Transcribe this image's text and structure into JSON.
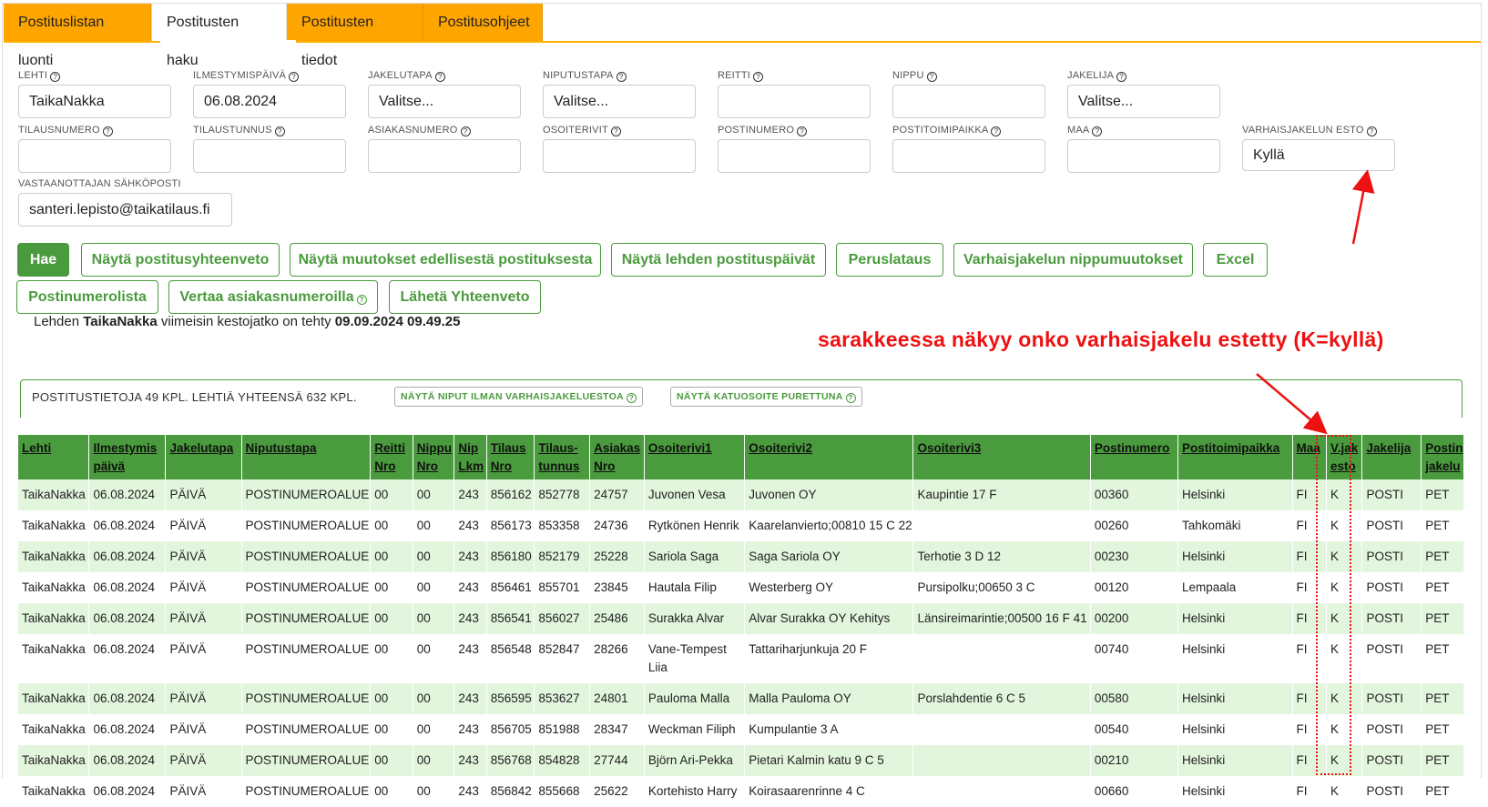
{
  "tabs": [
    {
      "label": "Postituslistan luonti",
      "active": false
    },
    {
      "label": "Postitusten haku",
      "active": true
    },
    {
      "label": "Postitusten tiedot",
      "active": false
    },
    {
      "label": "Postitusohjeet",
      "active": false
    }
  ],
  "form": {
    "lehti": {
      "label": "LEHTI",
      "value": "TaikaNakka"
    },
    "ilmestymispaiva": {
      "label": "ILMESTYMISPÄIVÄ",
      "value": "06.08.2024"
    },
    "jakelutapa": {
      "label": "JAKELUTAPA",
      "value": "Valitse..."
    },
    "niputustapa": {
      "label": "NIPUTUSTAPA",
      "value": "Valitse..."
    },
    "reitti": {
      "label": "REITTI",
      "value": ""
    },
    "nippu": {
      "label": "NIPPU",
      "value": ""
    },
    "jakelija": {
      "label": "JAKELIJA",
      "value": "Valitse..."
    },
    "tilausnumero": {
      "label": "TILAUSNUMERO",
      "value": ""
    },
    "tilaustunnus": {
      "label": "TILAUSTUNNUS",
      "value": ""
    },
    "asiakasnumero": {
      "label": "ASIAKASNUMERO",
      "value": ""
    },
    "osoiterivit": {
      "label": "OSOITERIVIT",
      "value": ""
    },
    "postinumero": {
      "label": "POSTINUMERO",
      "value": ""
    },
    "postitoimipaikka": {
      "label": "POSTITOIMIPAIKKA",
      "value": ""
    },
    "maa": {
      "label": "MAA",
      "value": ""
    },
    "varhaisjakelun_esto": {
      "label": "VARHAISJAKELUN ESTO",
      "value": "Kyllä"
    },
    "sahkoposti": {
      "label": "VASTAANOTTAJAN SÄHKÖPOSTI",
      "value": "santeri.lepisto@taikatilaus.fi"
    }
  },
  "help_glyph": "?",
  "buttons": {
    "hae": "Hae",
    "yhteenveto": "Näytä postitusyhteenveto",
    "muutokset": "Näytä muutokset edellisestä postituksesta",
    "postituspaivat": "Näytä lehden postituspäivät",
    "peruslataus": "Peruslataus",
    "nippumuutokset": "Varhaisjakelun nippumuutokset",
    "excel": "Excel",
    "postinumerolista": "Postinumerolista",
    "vertaa": "Vertaa asiakasnumeroilla",
    "laheta": "Lähetä Yhteenveto"
  },
  "info": {
    "prefix": "Lehden ",
    "paper": "TaikaNakka",
    "middle": " viimeisin kestojatko on tehty ",
    "datetime": "09.09.2024 09.49.25"
  },
  "annotation": "sarakkeessa näkyy onko varhaisjakelu estetty (K=kyllä)",
  "summary": {
    "text": "POSTITUSTIETOJA 49 KPL. LEHTIÄ YHTEENSÄ 632 KPL.",
    "btn_niput": "NÄYTÄ NIPUT ILMAN VARHAISJAKELUESTOA",
    "btn_katuosoite": "NÄYTÄ KATUOSOITE PURETTUNA"
  },
  "table": {
    "headers": [
      {
        "l1": "Lehti",
        "l2": ""
      },
      {
        "l1": "Ilmestymis",
        "l2": "päivä"
      },
      {
        "l1": "Jakelutapa",
        "l2": ""
      },
      {
        "l1": "Niputustapa",
        "l2": ""
      },
      {
        "l1": "Reitti",
        "l2": "Nro"
      },
      {
        "l1": "Nippu",
        "l2": "Nro"
      },
      {
        "l1": "Nip",
        "l2": "Lkm"
      },
      {
        "l1": "Tilaus",
        "l2": "Nro"
      },
      {
        "l1": "Tilaus-",
        "l2": "tunnus"
      },
      {
        "l1": "Asiakas",
        "l2": "Nro"
      },
      {
        "l1": "Osoiterivi1",
        "l2": ""
      },
      {
        "l1": "Osoiterivi2",
        "l2": ""
      },
      {
        "l1": "Osoiterivi3",
        "l2": ""
      },
      {
        "l1": "Postinumero",
        "l2": ""
      },
      {
        "l1": "Postitoimipaikka",
        "l2": ""
      },
      {
        "l1": "Maa",
        "l2": ""
      },
      {
        "l1": "V.jak",
        "l2": "esto"
      },
      {
        "l1": "Jakelija",
        "l2": ""
      },
      {
        "l1": "Postin",
        "l2": "jakelu"
      }
    ],
    "rows": [
      [
        "TaikaNakka",
        "06.08.2024",
        "PÄIVÄ",
        "POSTINUMEROALUE",
        "00",
        "00",
        "243",
        "856162",
        "852778",
        "24757",
        "Juvonen Vesa",
        "Juvonen OY",
        "Kaupintie 17 F",
        "00360",
        "Helsinki",
        "FI",
        "K",
        "POSTI",
        "PET"
      ],
      [
        "TaikaNakka",
        "06.08.2024",
        "PÄIVÄ",
        "POSTINUMEROALUE",
        "00",
        "00",
        "243",
        "856173",
        "853358",
        "24736",
        "Rytkönen Henrik",
        "Kaarelanvierto;00810 15 C 22",
        "",
        "00260",
        "Tahkomäki",
        "FI",
        "K",
        "POSTI",
        "PET"
      ],
      [
        "TaikaNakka",
        "06.08.2024",
        "PÄIVÄ",
        "POSTINUMEROALUE",
        "00",
        "00",
        "243",
        "856180",
        "852179",
        "25228",
        "Sariola Saga",
        "Saga Sariola OY",
        "Terhotie 3 D 12",
        "00230",
        "Helsinki",
        "FI",
        "K",
        "POSTI",
        "PET"
      ],
      [
        "TaikaNakka",
        "06.08.2024",
        "PÄIVÄ",
        "POSTINUMEROALUE",
        "00",
        "00",
        "243",
        "856461",
        "855701",
        "23845",
        "Hautala Filip",
        "Westerberg OY",
        "Pursipolku;00650 3 C",
        "00120",
        "Lempaala",
        "FI",
        "K",
        "POSTI",
        "PET"
      ],
      [
        "TaikaNakka",
        "06.08.2024",
        "PÄIVÄ",
        "POSTINUMEROALUE",
        "00",
        "00",
        "243",
        "856541",
        "856027",
        "25486",
        "Surakka Alvar",
        "Alvar Surakka OY Kehitys",
        "Länsireimarintie;00500 16 F 41",
        "00200",
        "Helsinki",
        "FI",
        "K",
        "POSTI",
        "PET"
      ],
      [
        "TaikaNakka",
        "06.08.2024",
        "PÄIVÄ",
        "POSTINUMEROALUE",
        "00",
        "00",
        "243",
        "856548",
        "852847",
        "28266",
        "Vane-Tempest Liia",
        "Tattariharjunkuja 20 F",
        "",
        "00740",
        "Helsinki",
        "FI",
        "K",
        "POSTI",
        "PET"
      ],
      [
        "TaikaNakka",
        "06.08.2024",
        "PÄIVÄ",
        "POSTINUMEROALUE",
        "00",
        "00",
        "243",
        "856595",
        "853627",
        "24801",
        "Pauloma Malla",
        "Malla Pauloma OY",
        "Porslahdentie 6 C 5",
        "00580",
        "Helsinki",
        "FI",
        "K",
        "POSTI",
        "PET"
      ],
      [
        "TaikaNakka",
        "06.08.2024",
        "PÄIVÄ",
        "POSTINUMEROALUE",
        "00",
        "00",
        "243",
        "856705",
        "851988",
        "28347",
        "Weckman Filiph",
        "Kumpulantie 3 A",
        "",
        "00540",
        "Helsinki",
        "FI",
        "K",
        "POSTI",
        "PET"
      ],
      [
        "TaikaNakka",
        "06.08.2024",
        "PÄIVÄ",
        "POSTINUMEROALUE",
        "00",
        "00",
        "243",
        "856768",
        "854828",
        "27744",
        "Björn Ari-Pekka",
        "Pietari Kalmin katu 9 C 5",
        "",
        "00210",
        "Helsinki",
        "FI",
        "K",
        "POSTI",
        "PET"
      ],
      [
        "TaikaNakka",
        "06.08.2024",
        "PÄIVÄ",
        "POSTINUMEROALUE",
        "00",
        "00",
        "243",
        "856842",
        "855668",
        "25622",
        "Kortehisto Harry",
        "Koirasaarenrinne 4 C",
        "",
        "00660",
        "Helsinki",
        "FI",
        "K",
        "POSTI",
        "PET"
      ]
    ]
  },
  "colors": {
    "tab": "#ffa500",
    "green": "#4a9b3d",
    "row_alt": "#e2f6dd",
    "annotation": "#ee1111"
  }
}
